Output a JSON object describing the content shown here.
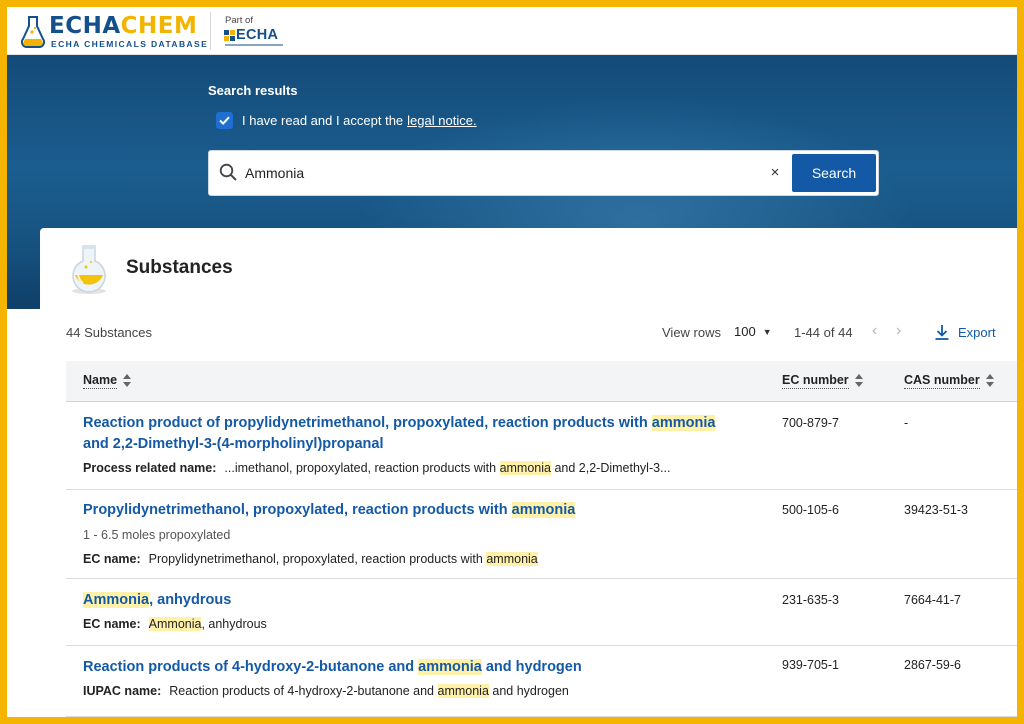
{
  "header": {
    "logo_primary": "ECHA",
    "logo_secondary": "CHEM",
    "logo_subtitle": "ECHA CHEMICALS DATABASE",
    "part_of": "Part of",
    "partner_logo": "ECHA"
  },
  "hero": {
    "title": "Search results",
    "accept_text": "I have read and I accept the",
    "accept_link": "legal notice.",
    "accept_checked": true,
    "search_value": "Ammonia",
    "clear_icon": "×",
    "search_button": "Search"
  },
  "panel": {
    "title": "Substances",
    "count": "44 Substances",
    "view_rows_label": "View rows",
    "view_rows_value": "100",
    "range": "1-44 of 44",
    "prev_icon": "‹",
    "next_icon": "›",
    "export_label": "Export"
  },
  "table": {
    "columns": [
      "Name",
      "EC number",
      "CAS number"
    ],
    "rows": [
      {
        "name_parts": [
          "Reaction product of propylidynetrimethanol, propoxylated, reaction products with ",
          "ammonia",
          " and 2,2-Dimethyl-3-(4-morpholinyl)propanal"
        ],
        "sub": "",
        "meta_key": "Process related name:",
        "meta_parts": [
          "...imethanol, propoxylated, reaction products with ",
          "ammonia",
          " and 2,2-Dimethyl-3..."
        ],
        "ec": "700-879-7",
        "cas": "-"
      },
      {
        "name_parts": [
          "Propylidynetrimethanol, propoxylated, reaction products with ",
          "ammonia",
          ""
        ],
        "sub": "1 - 6.5 moles propoxylated",
        "meta_key": "EC name:",
        "meta_parts": [
          "Propylidynetrimethanol, propoxylated, reaction products with ",
          "ammonia",
          ""
        ],
        "ec": "500-105-6",
        "cas": "39423-51-3"
      },
      {
        "name_parts": [
          "",
          "Ammonia",
          ", anhydrous"
        ],
        "sub": "",
        "meta_key": "EC name:",
        "meta_parts": [
          "",
          "Ammonia",
          ", anhydrous"
        ],
        "ec": "231-635-3",
        "cas": "7664-41-7"
      },
      {
        "name_parts": [
          "Reaction products of 4-hydroxy-2-butanone and ",
          "ammonia",
          " and hydrogen"
        ],
        "sub": "",
        "meta_key": "IUPAC name:",
        "meta_parts": [
          "Reaction products of 4-hydroxy-2-butanone and ",
          "ammonia",
          " and hydrogen"
        ],
        "ec": "939-705-1",
        "cas": "2867-59-6"
      }
    ]
  },
  "colors": {
    "frame": "#f5b400",
    "brand_blue": "#14508c",
    "brand_yellow": "#f2b400",
    "link_blue": "#1359a6",
    "highlight": "#fff2a8"
  },
  "icons": [
    "flask-icon",
    "search-icon",
    "close-icon",
    "chevron-down-icon",
    "chevron-left-icon",
    "chevron-right-icon",
    "download-icon",
    "sort-icon",
    "check-icon"
  ]
}
